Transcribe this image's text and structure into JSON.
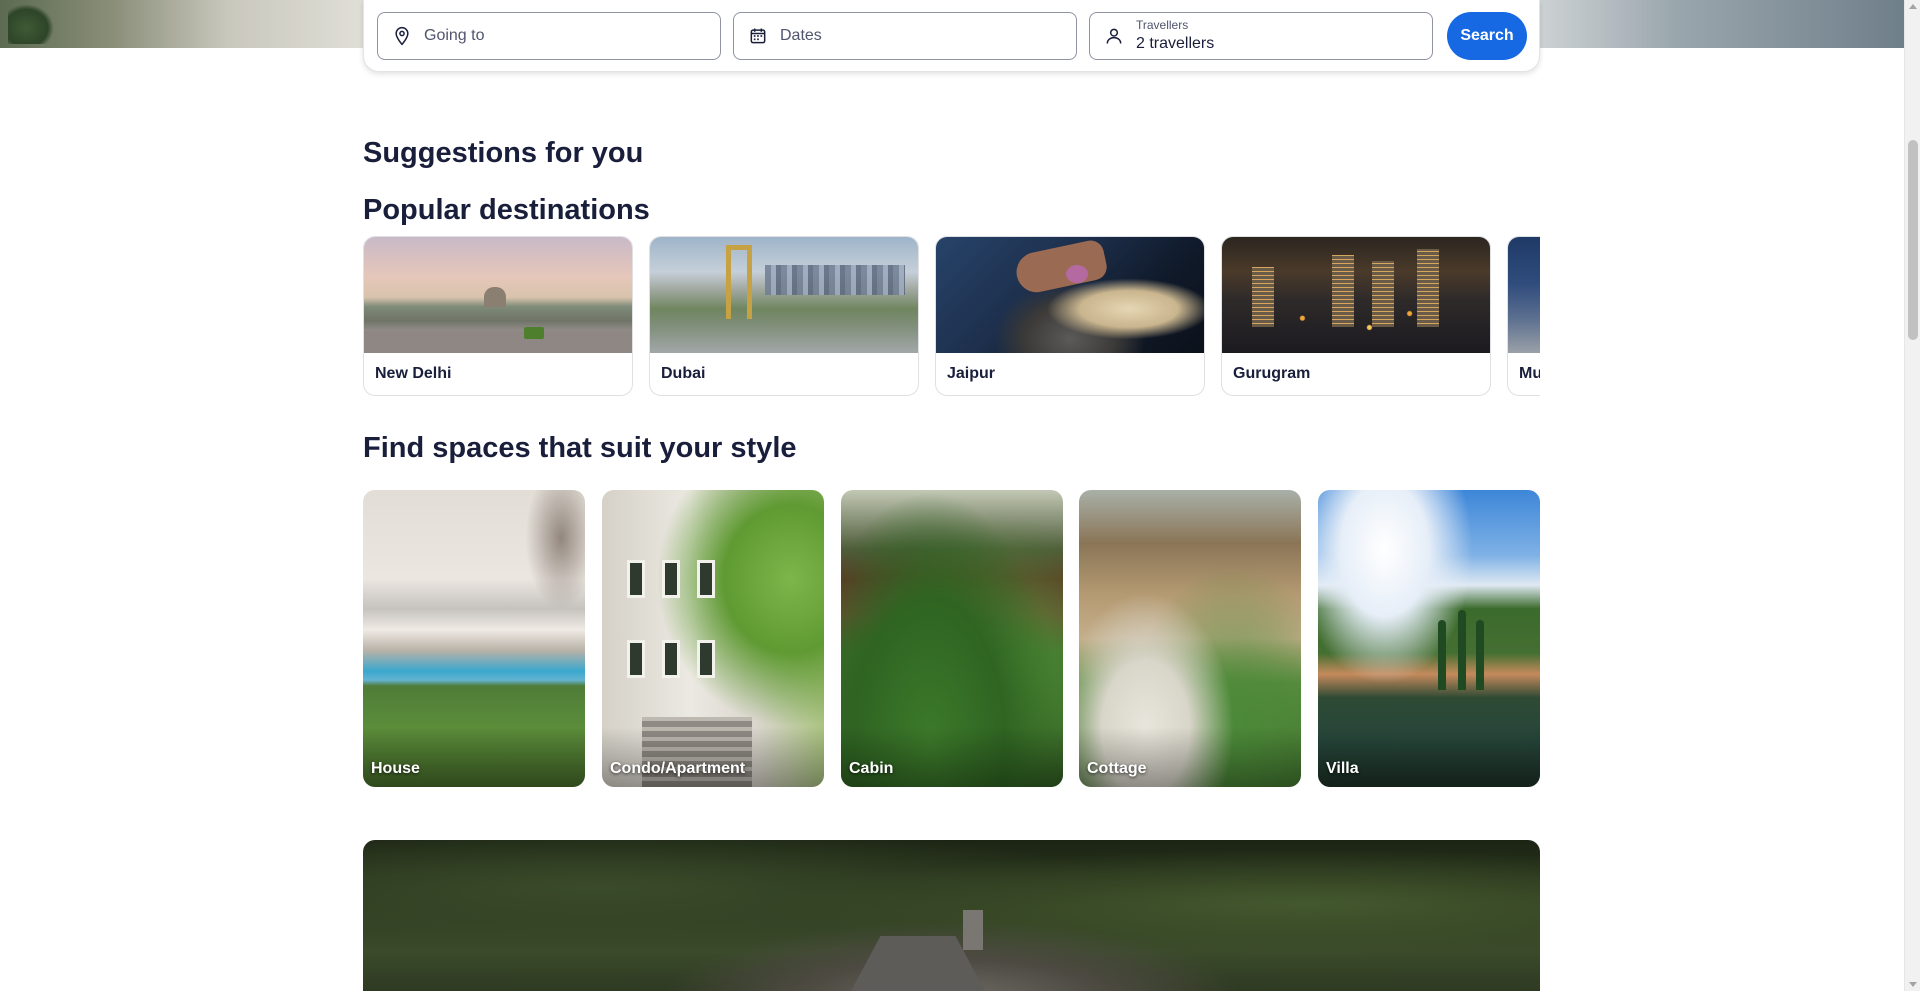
{
  "search": {
    "going_to_placeholder": "Going to",
    "dates_placeholder": "Dates",
    "travellers_label": "Travellers",
    "travellers_value": "2 travellers",
    "search_button": "Search"
  },
  "headings": {
    "suggestions": "Suggestions for you",
    "popular": "Popular destinations",
    "spaces": "Find spaces that suit your style"
  },
  "destinations": [
    {
      "name": "New Delhi"
    },
    {
      "name": "Dubai"
    },
    {
      "name": "Jaipur"
    },
    {
      "name": "Gurugram"
    },
    {
      "name": "Mu"
    }
  ],
  "styles": [
    {
      "label": "House"
    },
    {
      "label": "Condo/Apartment"
    },
    {
      "label": "Cabin"
    },
    {
      "label": "Cottage"
    },
    {
      "label": "Villa"
    }
  ],
  "colors": {
    "accent": "#1668e3",
    "text": "#191e3b",
    "muted": "#50556e"
  },
  "icons": {
    "going_to": "map-pin-icon",
    "dates": "calendar-icon",
    "travellers": "person-icon"
  }
}
